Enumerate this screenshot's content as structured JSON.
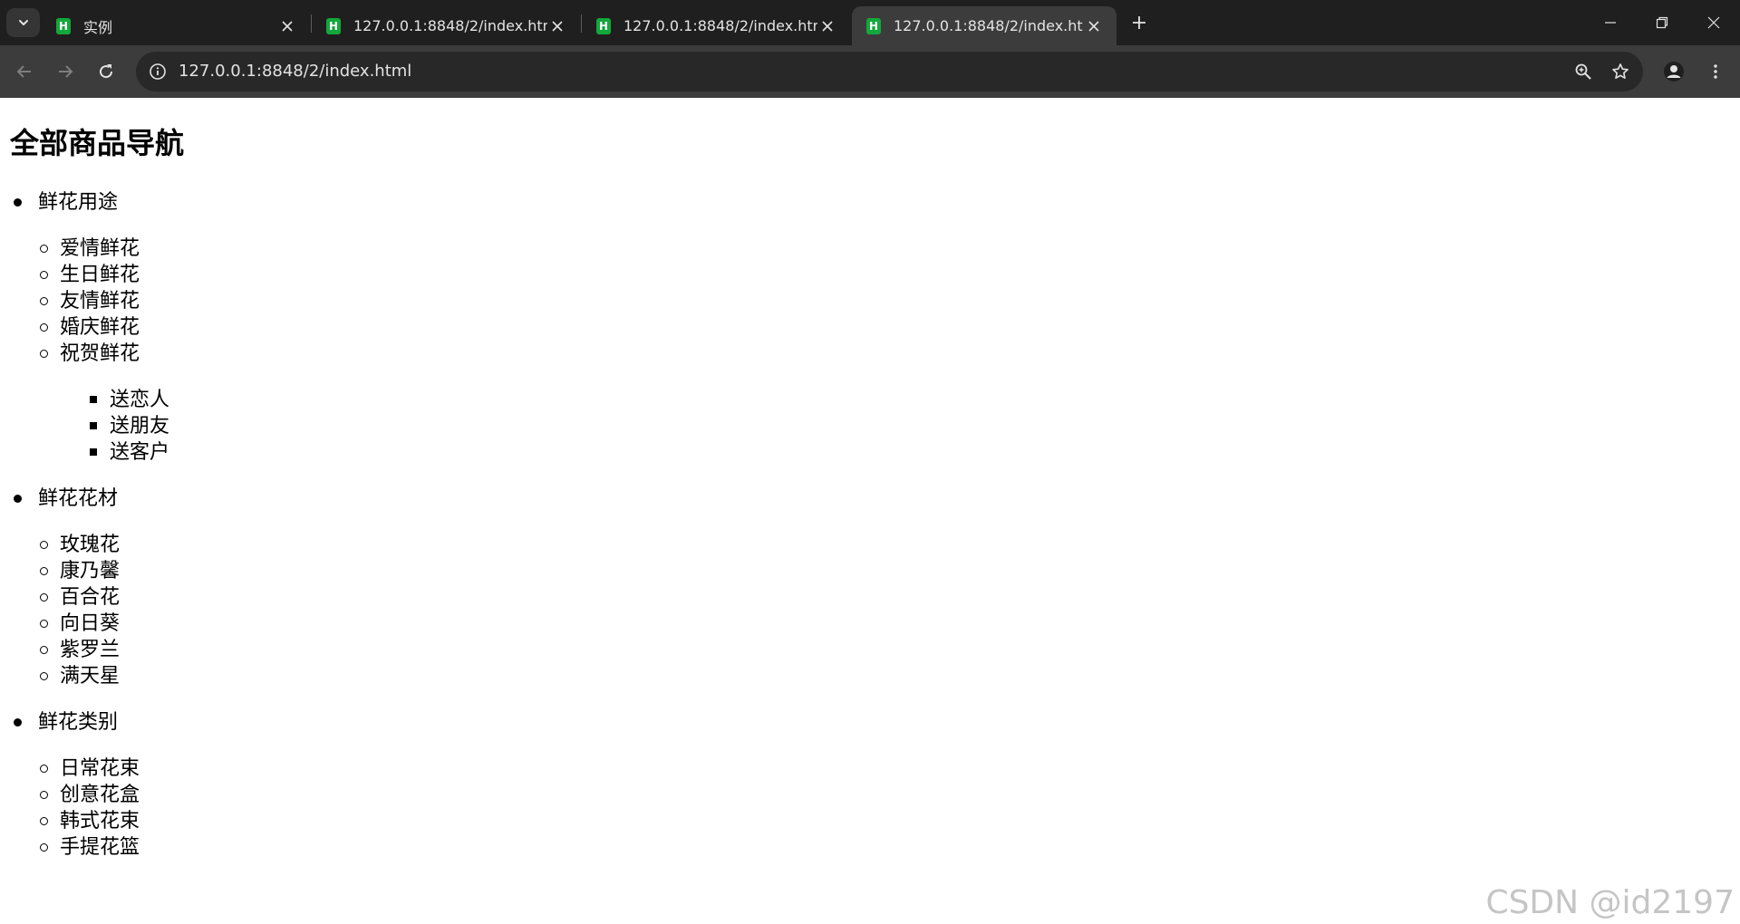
{
  "browser": {
    "tabs": [
      {
        "title": "实例",
        "active": false
      },
      {
        "title": "127.0.0.1:8848/2/index.html",
        "active": false
      },
      {
        "title": "127.0.0.1:8848/2/index.html",
        "active": false
      },
      {
        "title": "127.0.0.1:8848/2/index.html",
        "active": true
      }
    ],
    "favicon_letter": "H",
    "address_url": "127.0.0.1:8848/2/index.html"
  },
  "page": {
    "heading": "全部商品导航",
    "categories": [
      {
        "label": "鲜花用途",
        "items": [
          "爱情鲜花",
          "生日鲜花",
          "友情鲜花",
          "婚庆鲜花",
          "祝贺鲜花"
        ],
        "subitems": [
          "送恋人",
          "送朋友",
          "送客户"
        ]
      },
      {
        "label": "鲜花花材",
        "items": [
          "玫瑰花",
          "康乃馨",
          "百合花",
          "向日葵",
          "紫罗兰",
          "满天星"
        ]
      },
      {
        "label": "鲜花类别",
        "items": [
          "日常花束",
          "创意花盒",
          "韩式花束",
          "手提花篮"
        ]
      }
    ]
  },
  "watermark": "CSDN @id2197",
  "colors": {
    "tabstrip_bg": "#1f1f1f",
    "toolbar_bg": "#3c3c3c",
    "omnibox_bg": "#282828",
    "favicon_green": "#13a83b",
    "text_light": "#e3e3e3"
  }
}
